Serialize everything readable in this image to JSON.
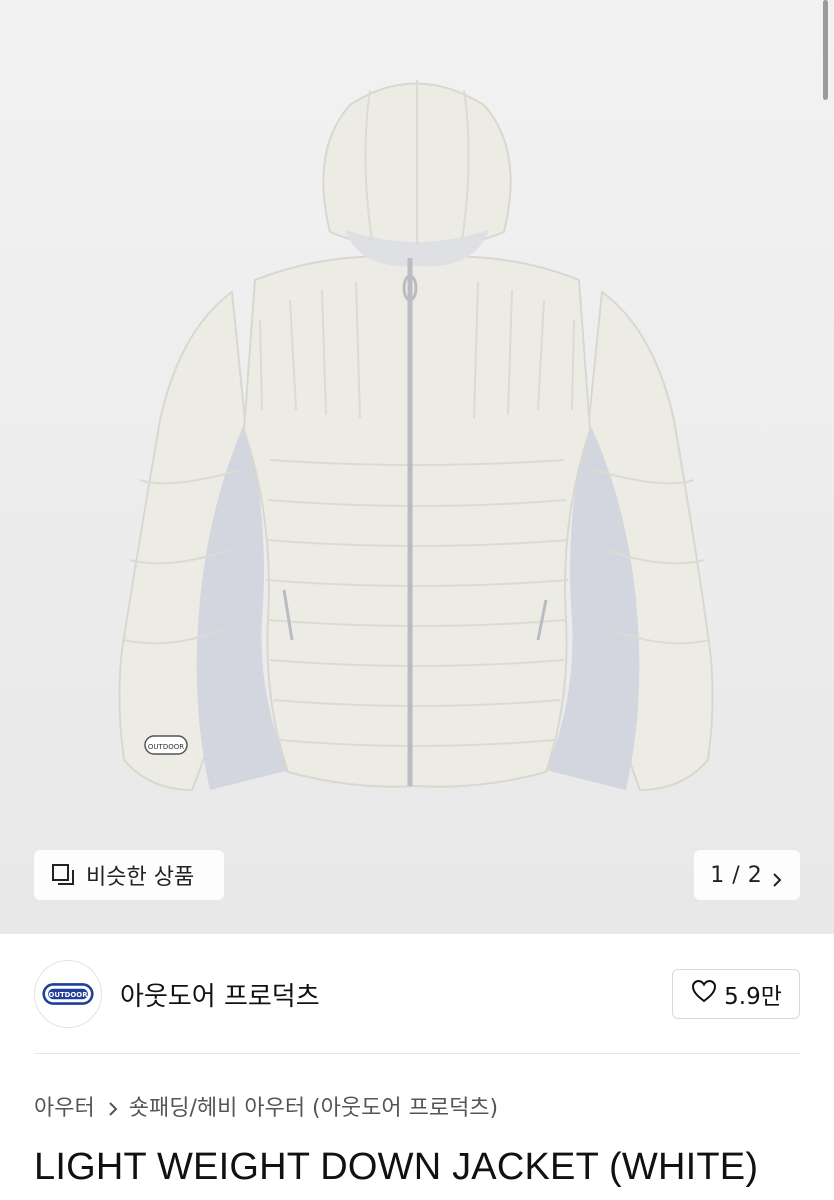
{
  "gallery": {
    "similar_label": "비슷한 상품",
    "page_current": "1",
    "page_separator": "/",
    "page_total": "2",
    "image_alt": "LIGHT WEIGHT DOWN JACKET (WHITE)",
    "badge_text": "OUTDOOR"
  },
  "store": {
    "name": "아웃도어 프로덕츠",
    "logo_text": "OUTDOOR",
    "likes": "5.9만"
  },
  "breadcrumb": {
    "category": "아우터",
    "subcategory": "숏패딩/헤비 아우터 (아웃도어 프로덕츠)"
  },
  "product": {
    "title": "LIGHT WEIGHT DOWN JACKET (WHITE)"
  },
  "colors": {
    "jacket_body": "#ecebe4",
    "jacket_panel": "#d3d6de",
    "zipper": "#b9bcc2",
    "brand_blue": "#1f3f9a"
  },
  "icons": {
    "similar": "similar-items-icon",
    "next": "chevron-right-icon",
    "like": "heart-outline-icon",
    "breadcrumb_sep": "chevron-right-icon"
  }
}
